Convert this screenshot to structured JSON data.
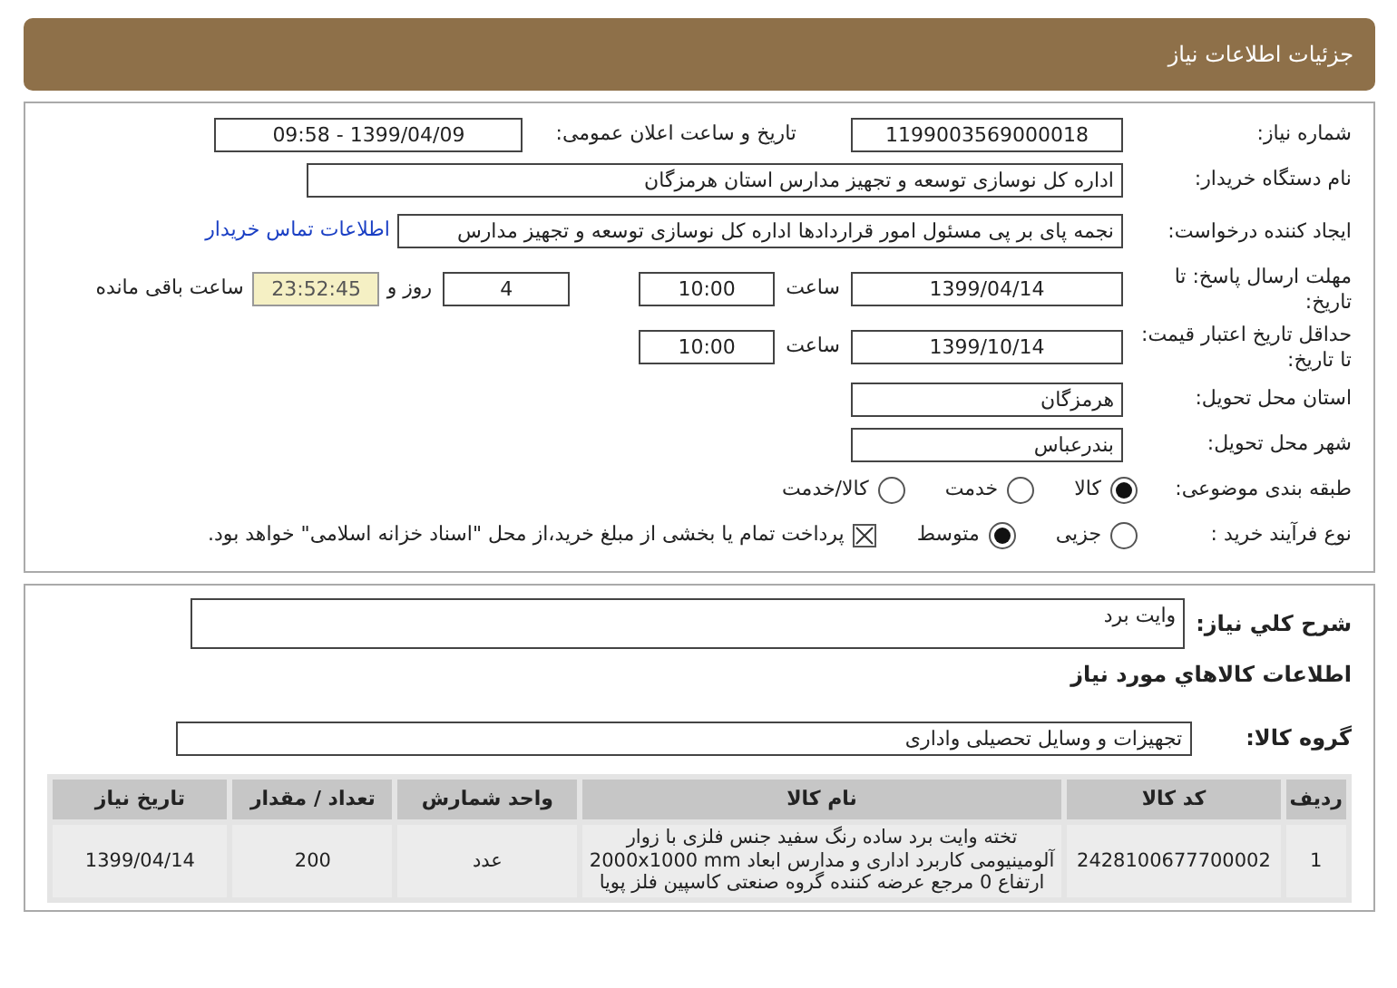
{
  "header": {
    "title": "جزئیات اطلاعات نیاز"
  },
  "need_number": {
    "label": "شماره نیاز:",
    "value": "1199003569000018"
  },
  "announce": {
    "label": "تاریخ و ساعت اعلان عمومی:",
    "value": "1399/04/09 - 09:58"
  },
  "buyer": {
    "label": "نام دستگاه خریدار:",
    "value": "اداره کل نوسازی توسعه و تجهیز مدارس استان هرمزگان"
  },
  "requester": {
    "label": "ایجاد کننده درخواست:",
    "value": "نجمه  پای بر پی مسئول امور قراردادها اداره کل نوسازی توسعه و تجهیز مدارس",
    "link": "اطلاعات تماس خریدار"
  },
  "deadline": {
    "label": "مهلت ارسال پاسخ: تا تاریخ:",
    "date": "1399/04/14",
    "time_label": "ساعت",
    "time": "10:00",
    "days": "4",
    "days_label": "روز و",
    "remaining": "23:52:45",
    "remaining_label": "ساعت باقی مانده"
  },
  "validity": {
    "label": "حداقل تاریخ اعتبار قیمت: تا تاریخ:",
    "date": "1399/10/14",
    "time_label": "ساعت",
    "time": "10:00"
  },
  "province": {
    "label": "استان محل تحویل:",
    "value": "هرمزگان"
  },
  "city": {
    "label": "شهر محل تحویل:",
    "value": "بندرعباس"
  },
  "category": {
    "label": "طبقه بندی موضوعی:",
    "options": [
      {
        "label": "کالا",
        "selected": true
      },
      {
        "label": "خدمت",
        "selected": false
      },
      {
        "label": "کالا/خدمت",
        "selected": false
      }
    ]
  },
  "process": {
    "label": "نوع فرآیند خرید :",
    "options": [
      {
        "label": "جزیی",
        "selected": false
      },
      {
        "label": "متوسط",
        "selected": true
      }
    ],
    "treasury": {
      "checked": true,
      "text": "پرداخت تمام یا بخشی از مبلغ خرید،از محل \"اسناد خزانه اسلامی\" خواهد بود."
    }
  },
  "description": {
    "label": "شرح كلي نياز:",
    "value": "وایت برد"
  },
  "goods_title": "اطلاعات كالاهاي مورد نياز",
  "goods_group": {
    "label": "گروه کالا:",
    "value": "تجهیزات و وسایل تحصیلی واداری"
  },
  "table": {
    "columns": [
      "ردیف",
      "کد کالا",
      "نام کالا",
      "واحد شمارش",
      "تعداد / مقدار",
      "تاریخ نیاز"
    ],
    "rows": [
      [
        "1",
        "2428100677700002",
        "تخته وایت برد ساده رنگ سفید جنس فلزی با زوار آلومینیومی کاربرد اداری و مدارس ابعاد 2000x1000 mm ارتفاع 0 مرجع عرضه کننده گروه صنعتی کاسپین فلز پویا",
        "عدد",
        "200",
        "1399/04/14"
      ]
    ]
  }
}
